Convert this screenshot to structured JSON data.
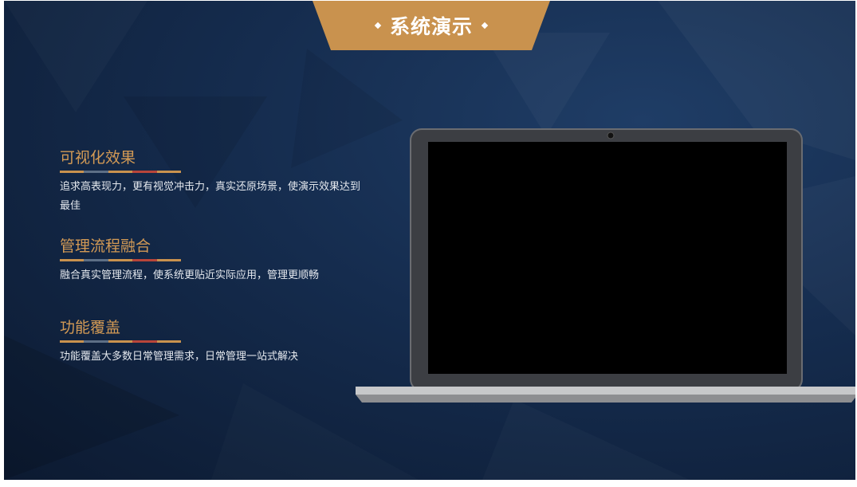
{
  "banner": {
    "title": "系统演示"
  },
  "features": [
    {
      "title": "可视化效果",
      "desc": "追求高表现力，更有视觉冲击力，真实还原场景，使演示效果达到最佳"
    },
    {
      "title": "管理流程融合",
      "desc": "融合真实管理流程，使系统更贴近实际应用，管理更顺畅"
    },
    {
      "title": "功能覆盖",
      "desc": "功能覆盖大多数日常管理需求，日常管理一站式解决"
    }
  ],
  "colors": {
    "accent": "#c9924e",
    "background": "#152c4e",
    "title": "#d39a55",
    "underline": [
      "#c9924e",
      "#5d6f86",
      "#c9924e",
      "#b8453a",
      "#c9924e"
    ]
  }
}
